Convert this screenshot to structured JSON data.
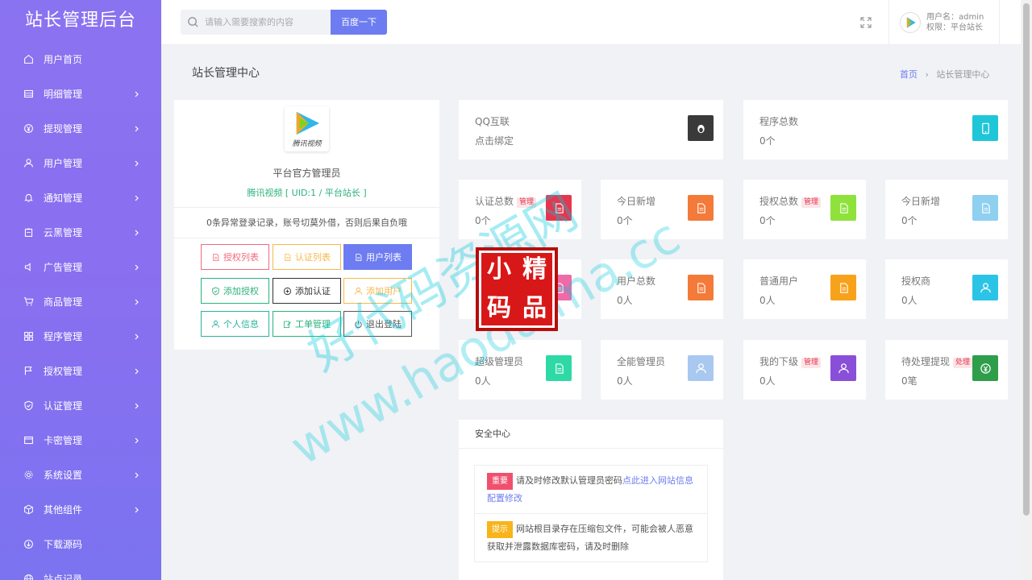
{
  "brand": "站长管理后台",
  "sidebar": {
    "items": [
      {
        "label": "用户首页",
        "icon": "home-icon",
        "chevron": false
      },
      {
        "label": "明细管理",
        "icon": "list-icon",
        "chevron": true
      },
      {
        "label": "提现管理",
        "icon": "yen-icon",
        "chevron": true
      },
      {
        "label": "用户管理",
        "icon": "user-icon",
        "chevron": true
      },
      {
        "label": "通知管理",
        "icon": "bell-icon",
        "chevron": true
      },
      {
        "label": "云黑管理",
        "icon": "clipboard-icon",
        "chevron": true
      },
      {
        "label": "广告管理",
        "icon": "speaker-icon",
        "chevron": true
      },
      {
        "label": "商品管理",
        "icon": "cart-icon",
        "chevron": true
      },
      {
        "label": "程序管理",
        "icon": "apps-icon",
        "chevron": true
      },
      {
        "label": "授权管理",
        "icon": "flag-icon",
        "chevron": true
      },
      {
        "label": "认证管理",
        "icon": "shield-check-icon",
        "chevron": true
      },
      {
        "label": "卡密管理",
        "icon": "card-icon",
        "chevron": true
      },
      {
        "label": "系统设置",
        "icon": "gear-icon",
        "chevron": true
      },
      {
        "label": "其他组件",
        "icon": "box-icon",
        "chevron": true
      },
      {
        "label": "下载源码",
        "icon": "download-icon",
        "chevron": false
      },
      {
        "label": "站点记录",
        "icon": "globe-icon",
        "chevron": false
      }
    ]
  },
  "header": {
    "search_placeholder": "请输入需要搜索的内容",
    "search_button": "百度一下",
    "username_line": "用户名：admin",
    "role_line": "权限：平台站长"
  },
  "page": {
    "title": "站长管理中心",
    "breadcrumb_home": "首页",
    "breadcrumb_sep": "›",
    "breadcrumb_current": "站长管理中心"
  },
  "profile": {
    "logo_text": "腾讯视频",
    "name": "平台官方管理员",
    "uid_line": "腾讯视频 [ UID:1 / 平台站长 ]",
    "warning": "0条异常登录记录，账号切莫外借，否则后果自负哦",
    "buttons": [
      {
        "label": "授权列表",
        "icon": "doc-icon",
        "color": "#f06a7e",
        "filled": false
      },
      {
        "label": "认证列表",
        "icon": "doc-icon",
        "color": "#f5b94a",
        "filled": false
      },
      {
        "label": "用户列表",
        "icon": "doc-icon",
        "color": "#6d7cf0",
        "filled": true
      },
      {
        "label": "添加授权",
        "icon": "shield-check-icon",
        "color": "#2ab27b",
        "filled": false
      },
      {
        "label": "添加认证",
        "icon": "plus-circle-icon",
        "color": "#333333",
        "filled": false
      },
      {
        "label": "添加用户",
        "icon": "user-icon",
        "color": "#f5b94a",
        "filled": false
      },
      {
        "label": "个人信息",
        "icon": "user-icon",
        "color": "#2ab2a0",
        "filled": false
      },
      {
        "label": "工单管理",
        "icon": "edit-icon",
        "color": "#2ab27b",
        "filled": false
      },
      {
        "label": "退出登陆",
        "icon": "power-icon",
        "color": "#555555",
        "filled": false
      }
    ]
  },
  "stats": [
    {
      "title": "QQ互联",
      "value": "点击绑定",
      "tag": "",
      "tag_color": "",
      "icon": "penguin-icon",
      "icon_bg": "#3a3a3a",
      "size": "wide"
    },
    {
      "title": "程序总数",
      "value": "0个",
      "tag": "",
      "tag_color": "",
      "icon": "phone-icon",
      "icon_bg": "#1fc6d8",
      "size": "wide"
    },
    {
      "title": "认证总数",
      "value": "0个",
      "tag": "管理",
      "tag_color": "#e5364e",
      "icon": "doc-icon",
      "icon_bg": "#e5364e"
    },
    {
      "title": "今日新增",
      "value": "0个",
      "tag": "",
      "tag_color": "",
      "icon": "doc-icon",
      "icon_bg": "#f47a3a"
    },
    {
      "title": "授权总数",
      "value": "0个",
      "tag": "管理",
      "tag_color": "#e5364e",
      "icon": "doc-icon",
      "icon_bg": "#8ee23a"
    },
    {
      "title": "今日新增",
      "value": "0个",
      "tag": "",
      "tag_color": "",
      "icon": "doc-icon",
      "icon_bg": "#8fd0f0"
    },
    {
      "title": "",
      "value": "",
      "tag": "",
      "tag_color": "",
      "icon": "doc-icon",
      "icon_bg": "#f06aa8"
    },
    {
      "title": "用户总数",
      "value": "0人",
      "tag": "",
      "tag_color": "",
      "icon": "doc-icon",
      "icon_bg": "#f47a3a"
    },
    {
      "title": "普通用户",
      "value": "0人",
      "tag": "",
      "tag_color": "",
      "icon": "doc-icon",
      "icon_bg": "#f8a21b"
    },
    {
      "title": "授权商",
      "value": "0人",
      "tag": "",
      "tag_color": "",
      "icon": "user-icon",
      "icon_bg": "#2cc4e6"
    },
    {
      "title": "超级管理员",
      "value": "0人",
      "tag": "",
      "tag_color": "",
      "icon": "doc-icon",
      "icon_bg": "#2fd9a6"
    },
    {
      "title": "全能管理员",
      "value": "0人",
      "tag": "",
      "tag_color": "",
      "icon": "user-icon",
      "icon_bg": "#a8c8f0"
    },
    {
      "title": "我的下级",
      "value": "0人",
      "tag": "管理",
      "tag_color": "#e5364e",
      "icon": "user-icon",
      "icon_bg": "#8a4fd8"
    },
    {
      "title": "待处理提现",
      "value": "0笔",
      "tag": "处理",
      "tag_color": "#e5364e",
      "icon": "yen-icon",
      "icon_bg": "#2e9e4a"
    }
  ],
  "security": {
    "title": "安全中心",
    "items": [
      {
        "badge": "重要",
        "badge_color": "#f0506e",
        "text": "请及时修改默认管理员密码",
        "link": "点此进入网站信息配置修改"
      },
      {
        "badge": "提示",
        "badge_color": "#f8b41b",
        "text": "网站根目录存在压缩包文件，可能会被人恶意获取并泄露数据库密码，请及时删除",
        "link": ""
      }
    ]
  },
  "watermark": {
    "line1": "好代码资源网",
    "line2": "www.haodaima.cc",
    "seal_chars": [
      "小",
      "精",
      "码",
      "品"
    ]
  }
}
